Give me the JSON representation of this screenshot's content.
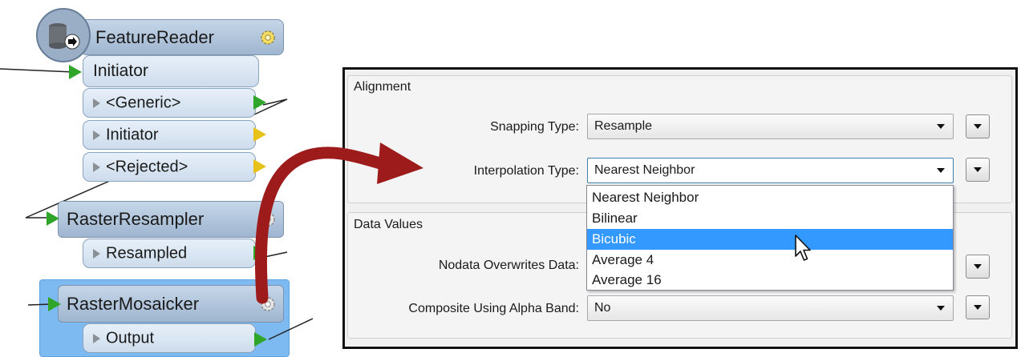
{
  "workbench": {
    "feature_reader": {
      "title": "FeatureReader",
      "ports": [
        "Initiator",
        "<Generic>",
        "Initiator",
        "<Rejected>"
      ]
    },
    "raster_resampler": {
      "title": "RasterResampler",
      "ports": [
        "Resampled"
      ]
    },
    "raster_mosaicker": {
      "title": "RasterMosaicker",
      "ports": [
        "Output"
      ]
    }
  },
  "dialog": {
    "alignment": {
      "title": "Alignment",
      "snapping_label": "Snapping Type:",
      "snapping_value": "Resample",
      "interpolation_label": "Interpolation Type:",
      "interpolation_value": "Nearest Neighbor"
    },
    "data_values": {
      "title": "Data Values",
      "nodata_label": "Nodata Overwrites Data:",
      "composite_label": "Composite Using Alpha Band:",
      "composite_value": "No"
    },
    "interpolation_options": [
      "Nearest Neighbor",
      "Bilinear",
      "Bicubic",
      "Average 4",
      "Average 16"
    ],
    "highlighted_option": "Bicubic"
  },
  "colors": {
    "selection_highlight": "#3399ff",
    "callout_arrow": "#9e1b1b",
    "connection_port": "#2fa52a",
    "rejected_port": "#e8c21a",
    "selected_transformer": "#79b8f0"
  },
  "icons": [
    "database-reader-icon",
    "gear-icon",
    "cursor-icon",
    "dropdown-arrow-icon"
  ]
}
